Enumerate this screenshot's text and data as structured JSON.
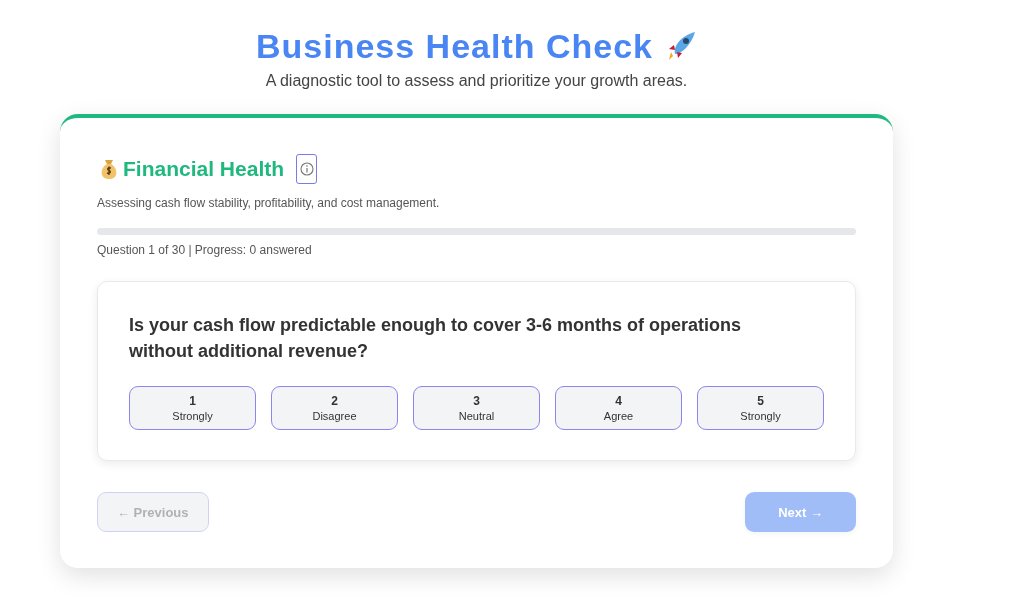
{
  "header": {
    "title": "Business Health Check",
    "subtitle": "A diagnostic tool to assess and prioritize your growth areas."
  },
  "section": {
    "title": "Financial Health",
    "description": "Assessing cash flow stability, profitability, and cost management.",
    "progress": {
      "level": 0,
      "label": "Question 1 of 30 | Progress: 0 answered"
    }
  },
  "question": {
    "text": "Is your cash flow predictable enough to cover 3-6 months of operations without additional revenue?",
    "options": [
      {
        "value": "1",
        "label": "Strongly",
        "selected": false
      },
      {
        "value": "2",
        "label": "Disagree",
        "selected": false
      },
      {
        "value": "3",
        "label": "Neutral",
        "selected": false
      },
      {
        "value": "4",
        "label": "Agree",
        "selected": false
      },
      {
        "value": "5",
        "label": "Strongly",
        "selected": false
      }
    ]
  },
  "navigation": [
    {
      "kind": "previous",
      "label": "← Previous",
      "disabled": true
    },
    {
      "kind": "next",
      "label": "Next →",
      "disabled": true
    }
  ]
}
